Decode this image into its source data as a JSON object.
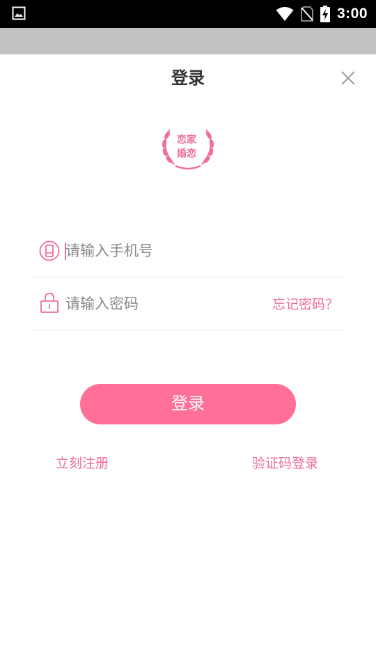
{
  "status_bar": {
    "time": "3:00",
    "icons": [
      "image-icon",
      "wifi-icon",
      "no-sim-icon",
      "battery-charging-icon"
    ]
  },
  "header": {
    "title": "登录",
    "close_icon": "close-icon"
  },
  "logo": {
    "line1": "恋家",
    "line2": "婚恋"
  },
  "phone_field": {
    "placeholder": "请输入手机号",
    "value": "",
    "icon": "phone-icon"
  },
  "password_field": {
    "placeholder": "请输入密码",
    "value": "",
    "icon": "lock-icon",
    "forgot_label": "忘记密码？"
  },
  "login_button": {
    "label": "登录"
  },
  "links": {
    "register": "立刻注册",
    "code_login": "验证码登录"
  },
  "colors": {
    "accent": "#ef6e96",
    "button": "#ff6f97",
    "status_bar": "#000000",
    "gray_band": "#c2c2c2"
  }
}
